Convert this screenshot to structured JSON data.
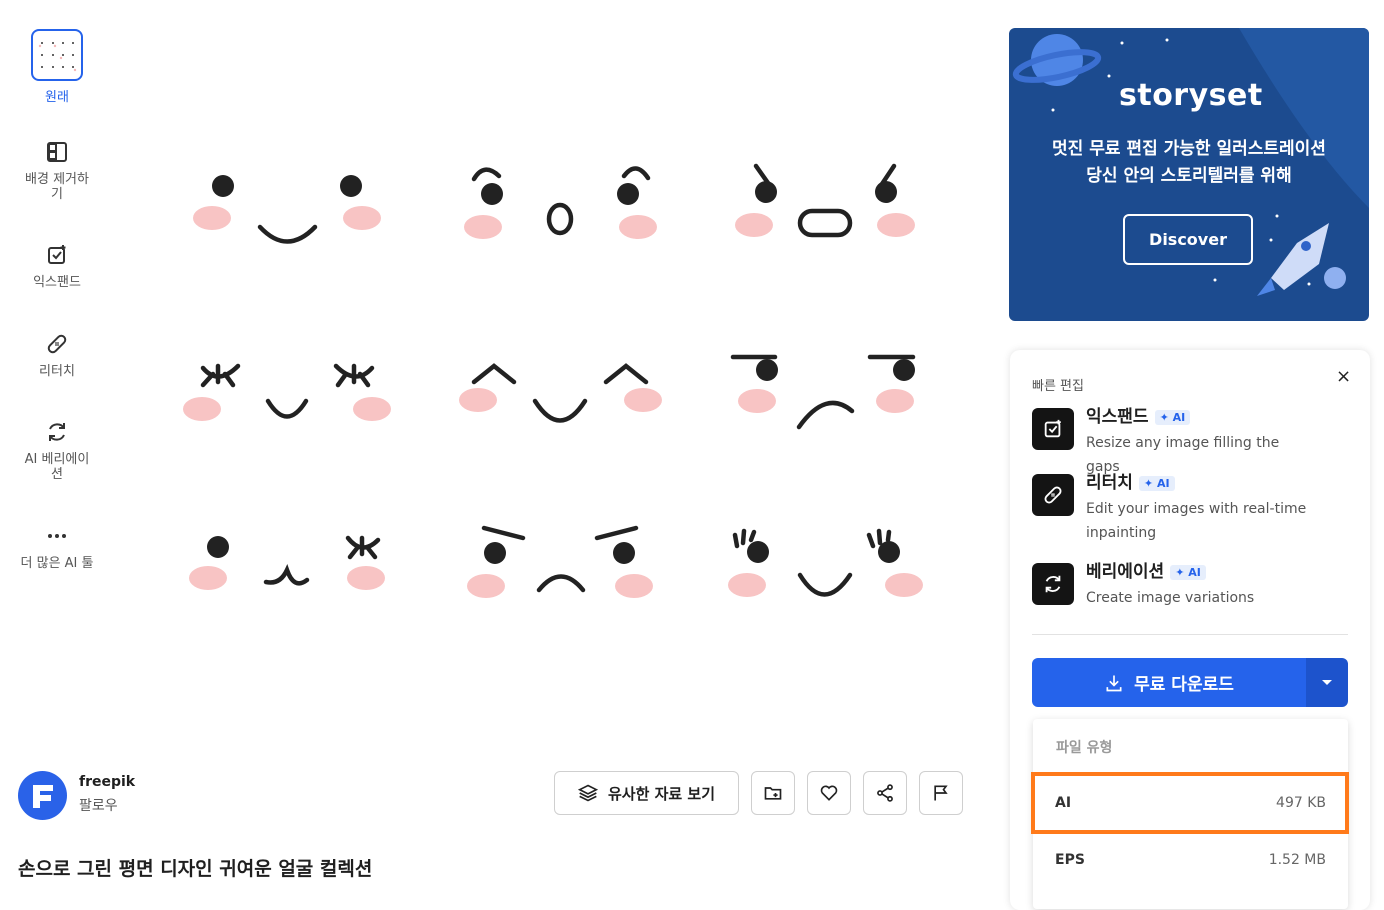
{
  "sidebar": {
    "original_label": "원래",
    "tools": [
      {
        "label": "배경 제거하\n기",
        "icon": "remove-background-icon"
      },
      {
        "label": "익스팬드",
        "icon": "expand-icon"
      },
      {
        "label": "리터치",
        "icon": "bandage-icon"
      },
      {
        "label": "AI 베리에이\n션",
        "icon": "refresh-icon"
      },
      {
        "label": "더 많은 AI 툴",
        "icon": "more-dots-icon"
      }
    ]
  },
  "author": {
    "name": "freepik",
    "follow": "팔로우",
    "avatar_letter": "F"
  },
  "title": "손으로 그린 평면 디자인 귀여운 얼굴 컬렉션",
  "actions": {
    "similar_label": "유사한 자료 보기"
  },
  "banner": {
    "logo": "storyset",
    "line1": "멋진 무료 편집 가능한 일러스트레이션",
    "line2": "당신 안의 스토리텔러를 위해",
    "button": "Discover"
  },
  "quick_edit": {
    "title": "빠른 편집",
    "close": "×",
    "items": [
      {
        "name": "익스팬드",
        "badge": "AI",
        "desc": "Resize any image filling the gaps"
      },
      {
        "name": "리터치",
        "badge": "AI",
        "desc": "Edit your images with real-time inpainting"
      },
      {
        "name": "베리에이션",
        "badge": "AI",
        "desc": "Create image variations"
      }
    ],
    "download_label": "무료 다운로드"
  },
  "file_menu": {
    "header": "파일 유형",
    "options": [
      {
        "format": "AI",
        "size": "497 KB",
        "highlighted": true
      },
      {
        "format": "EPS",
        "size": "1.52 MB",
        "highlighted": false
      }
    ]
  },
  "colors": {
    "accent": "#2563eb",
    "banner": "#1c4b8f",
    "highlight": "#ff7a1a",
    "blush": "#f8c4c4",
    "ink": "#222222"
  }
}
